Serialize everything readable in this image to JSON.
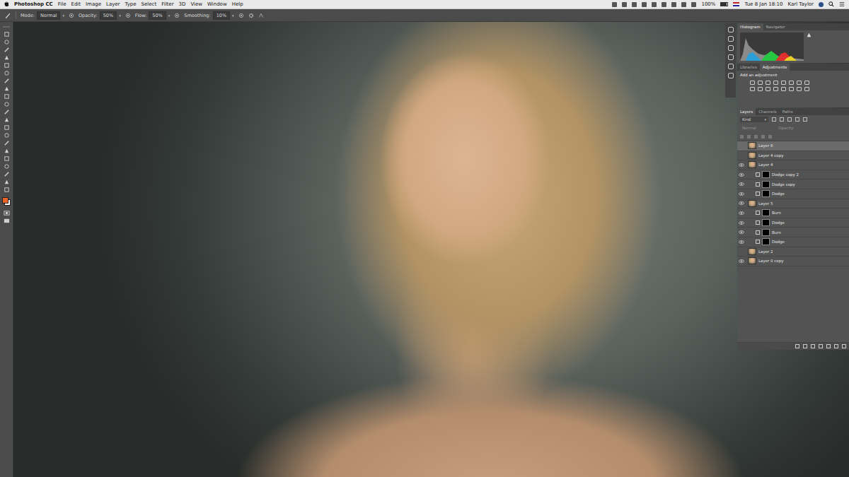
{
  "menubar": {
    "app": "Photoshop CC",
    "items": [
      "File",
      "Edit",
      "Image",
      "Layer",
      "Type",
      "Select",
      "Filter",
      "3D",
      "View",
      "Window",
      "Help"
    ],
    "status": {
      "battery": "100%",
      "clock": "Tue 8 Jan 18:10",
      "user": "Karl Taylor"
    }
  },
  "options": {
    "fields": [
      {
        "label": "Mode:",
        "value": "Normal"
      },
      {
        "label": "Opacity:",
        "value": "50%"
      },
      {
        "label": "Flow:",
        "value": "50%"
      },
      {
        "label": "Smoothing:",
        "value": "10%"
      }
    ]
  },
  "histogram_panel": {
    "tabs": [
      {
        "label": "Histogram",
        "selected": true
      },
      {
        "label": "Navigator",
        "selected": false
      }
    ]
  },
  "adjustments_panel": {
    "tabs": [
      {
        "label": "Libraries",
        "selected": false
      },
      {
        "label": "Adjustments",
        "selected": true
      }
    ],
    "hint": "Add an adjustment"
  },
  "layers_panel": {
    "tabs": [
      {
        "label": "Layers",
        "selected": true
      },
      {
        "label": "Channels",
        "selected": false
      },
      {
        "label": "Paths",
        "selected": false
      }
    ],
    "filter": "Kind",
    "blend": "Normal",
    "opacity_label": "Opacity:",
    "layers": [
      {
        "name": "Layer 6",
        "kind": "layer",
        "depth": 0,
        "visible": false,
        "selected": true
      },
      {
        "name": "Layer 4 copy",
        "kind": "layer",
        "depth": 0,
        "visible": false,
        "selected": false
      },
      {
        "name": "Layer 4",
        "kind": "layer",
        "depth": 0,
        "visible": true,
        "selected": false
      },
      {
        "name": "Dodge copy 2",
        "kind": "mask",
        "depth": 1,
        "visible": true,
        "selected": false
      },
      {
        "name": "Dodge copy",
        "kind": "mask",
        "depth": 1,
        "visible": true,
        "selected": false
      },
      {
        "name": "Dodge",
        "kind": "mask",
        "depth": 1,
        "visible": true,
        "selected": false
      },
      {
        "name": "Layer 5",
        "kind": "layer",
        "depth": 0,
        "visible": true,
        "selected": false
      },
      {
        "name": "Burn",
        "kind": "mask",
        "depth": 1,
        "visible": true,
        "selected": false
      },
      {
        "name": "Dodge",
        "kind": "mask",
        "depth": 1,
        "visible": true,
        "selected": false
      },
      {
        "name": "Burn",
        "kind": "mask",
        "depth": 1,
        "visible": true,
        "selected": false
      },
      {
        "name": "Dodge",
        "kind": "mask",
        "depth": 1,
        "visible": true,
        "selected": false
      },
      {
        "name": "Layer 2",
        "kind": "layer",
        "depth": 0,
        "visible": false,
        "selected": false
      },
      {
        "name": "Layer 0 copy",
        "kind": "layer",
        "depth": 0,
        "visible": true,
        "selected": false
      }
    ]
  }
}
